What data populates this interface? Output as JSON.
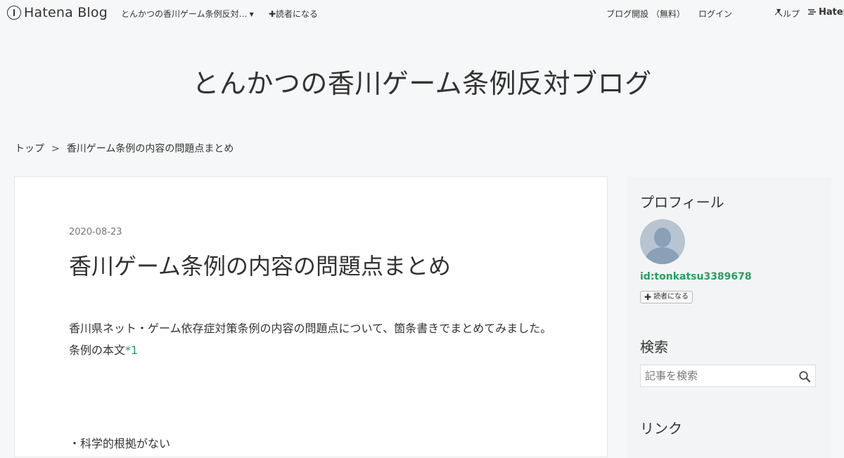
{
  "global_header": {
    "logo_text": "Hatena Blog",
    "blog_name": "とんかつの香川ゲーム条例反対…",
    "follow_label": "✚読者になる",
    "signup_label": "ブログ開設 （無料）",
    "login_label": "ログイン",
    "help_label": "ヘルプ",
    "hatena_label": "Hatena"
  },
  "blog": {
    "title": "とんかつの香川ゲーム条例反対ブログ"
  },
  "breadcrumb": {
    "top": "トップ",
    "separator": ">",
    "current": "香川ゲーム条例の内容の問題点まとめ"
  },
  "entry": {
    "date": "2020-08-23",
    "title": "香川ゲーム条例の内容の問題点まとめ",
    "paragraph": "香川県ネット・ゲーム依存症対策条例の内容の問題点について、箇条書きでまとめてみました。",
    "line2": "条例の本文",
    "footnote": "*1",
    "first_item": "・科学的根拠がない"
  },
  "sidebar": {
    "profile_title": "プロフィール",
    "profile_id": "id:tonkatsu3389678",
    "follow_button": "読者になる",
    "search_title": "検索",
    "search_placeholder": "記事を検索",
    "links_title": "リンク"
  },
  "colors": {
    "accent_green": "#2a9c5f",
    "background": "#f6f7f8"
  }
}
